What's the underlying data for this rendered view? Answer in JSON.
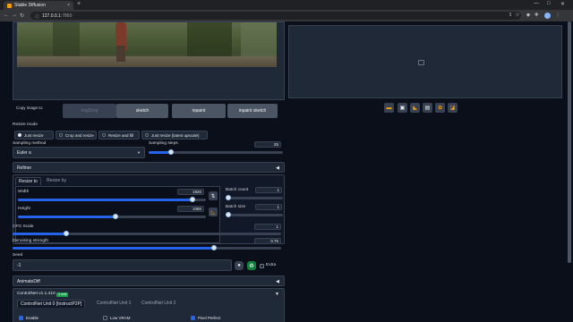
{
  "browser": {
    "tab_title": "Stable Diffusion",
    "tab_close": "×",
    "new_tab": "+",
    "url_host": "127.0.0.1",
    "url_port": ":7860",
    "back": "←",
    "forward": "→",
    "reload": "↻",
    "info": "ⓘ",
    "minimize": "—",
    "maximize": "□",
    "close": "✕",
    "toolbar_icons": [
      "share-icon",
      "star-icon",
      "extensions-icon",
      "puzzle-icon",
      "sidepanel-icon",
      "menu-icon"
    ]
  },
  "img2img": {
    "copy_label": "Copy image to:",
    "copy_buttons": [
      "img2img",
      "sketch",
      "inpaint",
      "inpaint sketch"
    ]
  },
  "resize_mode": {
    "label": "Resize mode",
    "options": [
      "Just resize",
      "Crop and resize",
      "Resize and fill",
      "Just resize (latent upscale)"
    ],
    "selected": "Just resize"
  },
  "sampling": {
    "method_label": "Sampling method",
    "method_value": "Euler a",
    "steps_label": "Sampling steps",
    "steps_value": "25",
    "steps_fraction": 0.167
  },
  "refiner": {
    "label": "Refiner"
  },
  "size": {
    "tabs": [
      "Resize to",
      "Resize by"
    ],
    "width_label": "Width",
    "width_value": "1920",
    "width_fraction": 0.93,
    "height_label": "Height",
    "height_value": "1080",
    "height_fraction": 0.52,
    "batch_count_label": "Batch count",
    "batch_count_value": "1",
    "batch_size_label": "Batch size",
    "batch_size_value": "1"
  },
  "cfg": {
    "label": "CFG Scale",
    "value": "1",
    "fraction": 0.2
  },
  "denoise": {
    "label": "Denoising strength",
    "value": "0.75",
    "fraction": 0.75
  },
  "seed": {
    "label": "Seed",
    "value": "-1",
    "extra_label": "Extra"
  },
  "animatediff": {
    "label": "AnimateDiff"
  },
  "controlnet": {
    "title": "ControlNet v1.1.410",
    "badge": "1 unit",
    "units": [
      "ControlNet Unit 0 [InstructP2P]",
      "ControlNet Unit 1",
      "ControlNet Unit 2"
    ],
    "options": [
      {
        "label": "Enable",
        "checked": true
      },
      {
        "label": "Low VRAM",
        "checked": false
      },
      {
        "label": "Pixel Perfect",
        "checked": true
      }
    ]
  },
  "output_tools": [
    "folder-icon",
    "save-icon",
    "zip-icon",
    "send-to-img2img-icon",
    "palette-icon",
    "send-to-extras-icon"
  ],
  "colors": {
    "accent": "#2563eb",
    "bg": "#0b0f19",
    "panel": "#1f2937",
    "border": "#374151"
  }
}
